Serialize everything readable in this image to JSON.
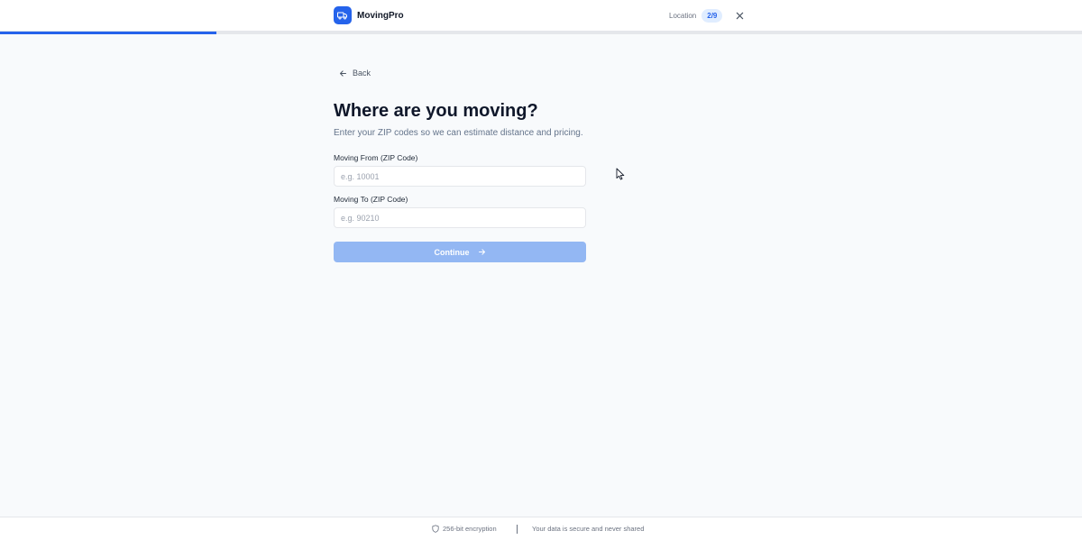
{
  "header": {
    "brand_name": "MovingPro",
    "brand_icon": "truck-icon",
    "step_label": "Location",
    "step_badge": "2/9",
    "close_icon": "close-icon"
  },
  "progress": {
    "fraction": 0.2
  },
  "content": {
    "back_label": "Back",
    "title": "Where are you moving?",
    "subtitle": "Enter your ZIP codes so we can estimate distance and pricing.",
    "from_label": "Moving From (ZIP Code)",
    "from_value": "",
    "from_placeholder": "e.g. 10001",
    "to_label": "Moving To (ZIP Code)",
    "to_value": "",
    "to_placeholder": "e.g. 90210",
    "continue_label": "Continue"
  },
  "footer": {
    "encryption_text": "256-bit encryption",
    "privacy_text": "Your data is secure and never shared"
  },
  "colors": {
    "accent": "#2563eb",
    "button_disabled": "#93b7f3",
    "background": "#f8fafc"
  }
}
